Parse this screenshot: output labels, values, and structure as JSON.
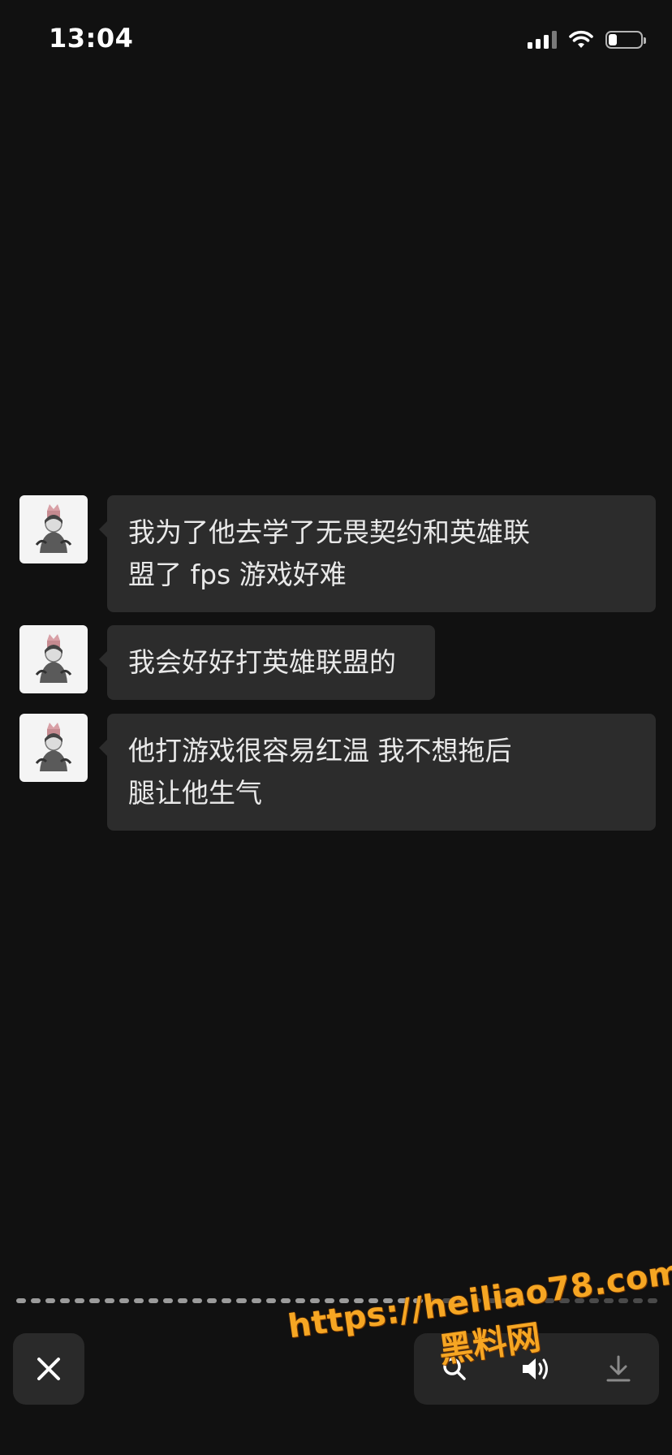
{
  "status_bar": {
    "time": "13:04",
    "battery_level": 0.25,
    "icons": [
      "signal-icon",
      "wifi-icon",
      "battery-icon"
    ]
  },
  "messages": [
    {
      "sender": "other",
      "text_line1": "我为了他去学了无畏契约和英雄联",
      "text_line2": "盟了 fps 游戏好难"
    },
    {
      "sender": "other",
      "text_line1": "我会好好打英雄联盟的"
    },
    {
      "sender": "other",
      "text_line1": "他打游戏很容易红温 我不想拖后",
      "text_line2": "腿让他生气"
    }
  ],
  "progress": {
    "segments": 44,
    "active": 28
  },
  "bottom_bar": {
    "buttons": [
      "close-icon",
      "search-icon",
      "speaker-icon",
      "download-icon"
    ]
  },
  "watermark": {
    "url": "https://heiliao78.com",
    "name": "黑料网"
  },
  "colors": {
    "background": "#111111",
    "bubble": "#2c2c2c",
    "watermark": "#f6a623"
  }
}
